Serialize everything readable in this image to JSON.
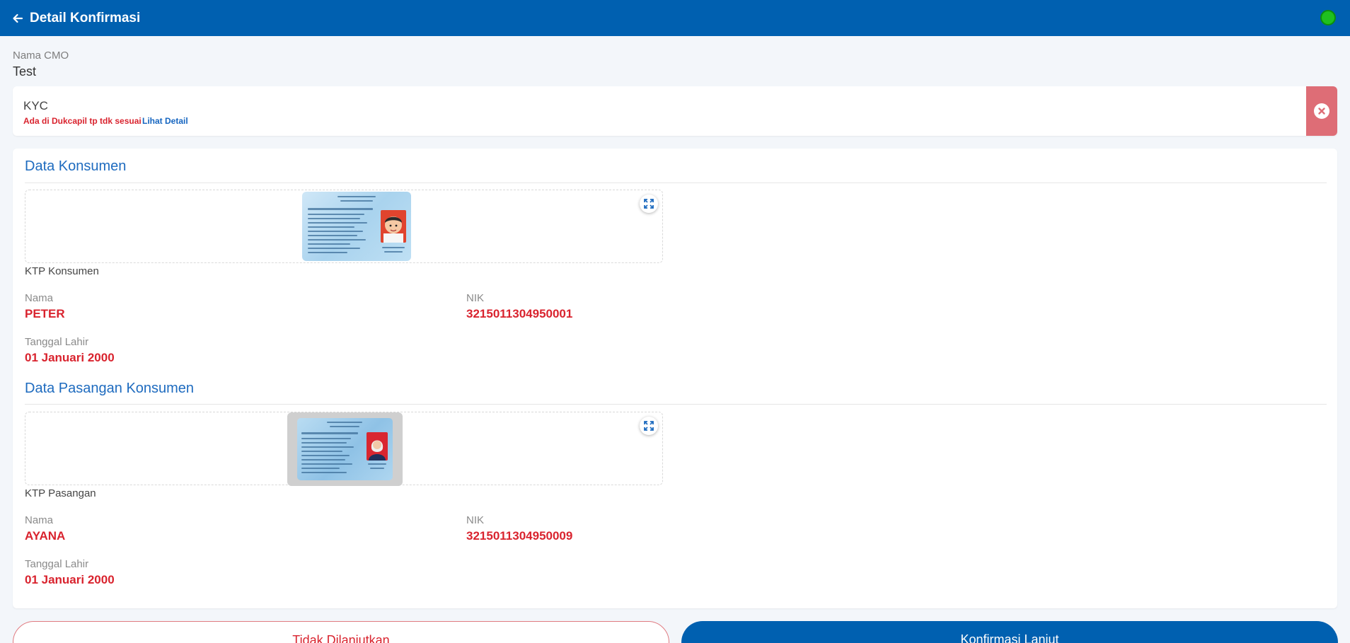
{
  "header": {
    "title": "Detail Konfirmasi",
    "status_color": "#1fc01f"
  },
  "cmo": {
    "label": "Nama CMO",
    "value": "Test"
  },
  "kyc": {
    "title": "KYC",
    "status": "Ada di Dukcapil tp tdk sesuai",
    "link": "Lihat Detail",
    "status_color": "#d9232e"
  },
  "konsumen": {
    "section_title": "Data Konsumen",
    "image_caption": "KTP Konsumen",
    "nama_label": "Nama",
    "nama_value": "PETER",
    "nik_label": "NIK",
    "nik_value": "3215011304950001",
    "tgl_label": "Tanggal Lahir",
    "tgl_value": "01 Januari 2000"
  },
  "pasangan": {
    "section_title": "Data Pasangan Konsumen",
    "image_caption": "KTP Pasangan",
    "nama_label": "Nama",
    "nama_value": "AYANA",
    "nik_label": "NIK",
    "nik_value": "3215011304950009",
    "tgl_label": "Tanggal Lahir",
    "tgl_value": "01 Januari 2000"
  },
  "buttons": {
    "reject": "Tidak Dilanjutkan",
    "confirm": "Konfirmasi Lanjut"
  },
  "colors": {
    "primary": "#0060b0",
    "danger": "#d9232e",
    "section_title": "#1e6bbf"
  }
}
